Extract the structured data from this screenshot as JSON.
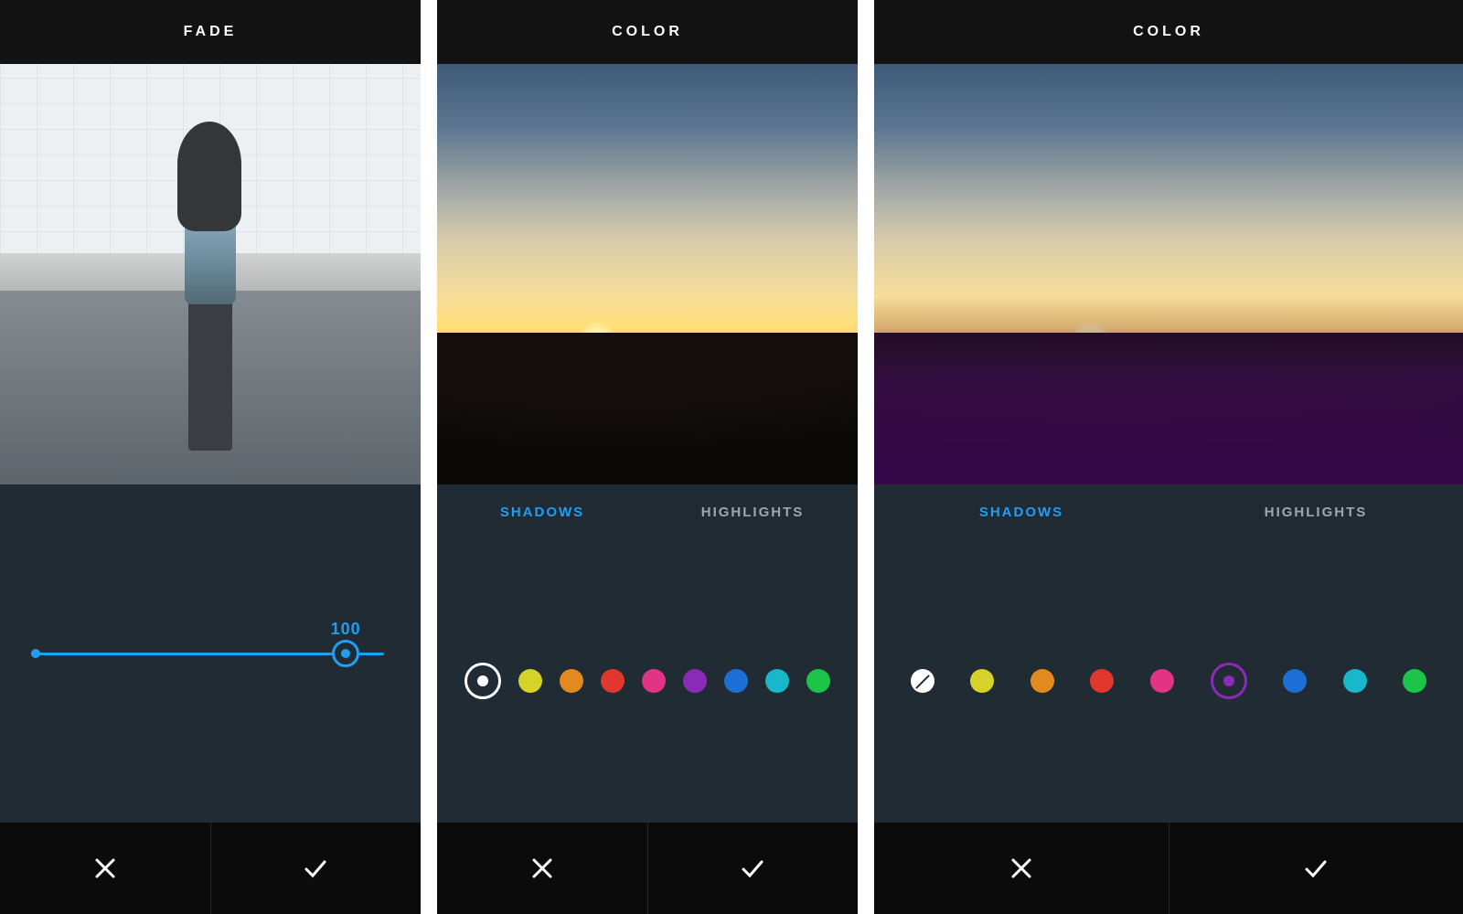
{
  "accent_color": "#1f9ff4",
  "screens": [
    {
      "title": "FADE",
      "slider": {
        "value": 100,
        "min": 0,
        "max": 100,
        "position_pct": 89
      }
    },
    {
      "title": "COLOR",
      "tabs": [
        {
          "label": "SHADOWS",
          "active": true
        },
        {
          "label": "HIGHLIGHTS",
          "active": false
        }
      ],
      "selected_swatch_index": 0,
      "swatches": [
        {
          "name": "none",
          "hex": "#ffffff",
          "kind": "ring"
        },
        {
          "name": "yellow",
          "hex": "#d7d22a",
          "kind": "solid"
        },
        {
          "name": "orange",
          "hex": "#e28a1f",
          "kind": "solid"
        },
        {
          "name": "red",
          "hex": "#e0372e",
          "kind": "solid"
        },
        {
          "name": "pink",
          "hex": "#e23386",
          "kind": "solid"
        },
        {
          "name": "purple",
          "hex": "#8a2bb8",
          "kind": "solid"
        },
        {
          "name": "blue",
          "hex": "#1d6fd6",
          "kind": "solid"
        },
        {
          "name": "cyan",
          "hex": "#18b7c9",
          "kind": "solid"
        },
        {
          "name": "green",
          "hex": "#1cc44a",
          "kind": "solid"
        }
      ]
    },
    {
      "title": "COLOR",
      "tabs": [
        {
          "label": "SHADOWS",
          "active": true
        },
        {
          "label": "HIGHLIGHTS",
          "active": false
        }
      ],
      "selected_swatch_index": 5,
      "swatches": [
        {
          "name": "none",
          "hex": "#ffffff",
          "kind": "none"
        },
        {
          "name": "yellow",
          "hex": "#d7d22a",
          "kind": "solid"
        },
        {
          "name": "orange",
          "hex": "#e28a1f",
          "kind": "solid"
        },
        {
          "name": "red",
          "hex": "#e0372e",
          "kind": "solid"
        },
        {
          "name": "pink",
          "hex": "#e23386",
          "kind": "solid"
        },
        {
          "name": "purple",
          "hex": "#8a2bb8",
          "kind": "ring"
        },
        {
          "name": "blue",
          "hex": "#1d6fd6",
          "kind": "solid"
        },
        {
          "name": "cyan",
          "hex": "#18b7c9",
          "kind": "solid"
        },
        {
          "name": "green",
          "hex": "#1cc44a",
          "kind": "solid"
        }
      ]
    }
  ],
  "buttons": {
    "cancel": "cancel",
    "confirm": "confirm"
  }
}
